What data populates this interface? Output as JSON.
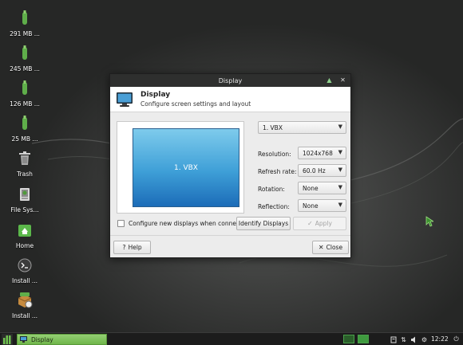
{
  "desktop": {
    "icons": [
      {
        "label": "291 MB ...",
        "icon": "usb-drive-icon"
      },
      {
        "label": "245 MB ...",
        "icon": "usb-drive-icon"
      },
      {
        "label": "126 MB ...",
        "icon": "usb-drive-icon"
      },
      {
        "label": "25 MB ...",
        "icon": "usb-drive-icon"
      },
      {
        "label": "Trash",
        "icon": "trash-icon"
      },
      {
        "label": "File Sys...",
        "icon": "file-system-icon"
      },
      {
        "label": "Home",
        "icon": "home-folder-icon"
      },
      {
        "label": "Install ...",
        "icon": "terminal-icon"
      },
      {
        "label": "Install ...",
        "icon": "installer-package-icon"
      }
    ]
  },
  "dialog": {
    "window_title": "Display",
    "header_title": "Display",
    "header_subtitle": "Configure screen settings and layout",
    "preview_monitor_label": "1. VBX",
    "output_select": "1. VBX",
    "resolution_label": "Resolution:",
    "resolution_value": "1024x768",
    "refresh_label": "Refresh rate:",
    "refresh_value": "60.0 Hz",
    "rotation_label": "Rotation:",
    "rotation_value": "None",
    "reflection_label": "Reflection:",
    "reflection_value": "None",
    "configure_checkbox_label": "Configure new displays when connected",
    "configure_checked": false,
    "identify_button": "Identify Displays",
    "apply_button": "Apply",
    "help_button": "Help",
    "close_button": "Close"
  },
  "taskbar": {
    "task_label": "Display",
    "clock": "12:22"
  },
  "colors": {
    "accent_green": "#6fb64a",
    "titlebar": "#2e2f2e",
    "desktop_bg": "#3c3d3c"
  }
}
